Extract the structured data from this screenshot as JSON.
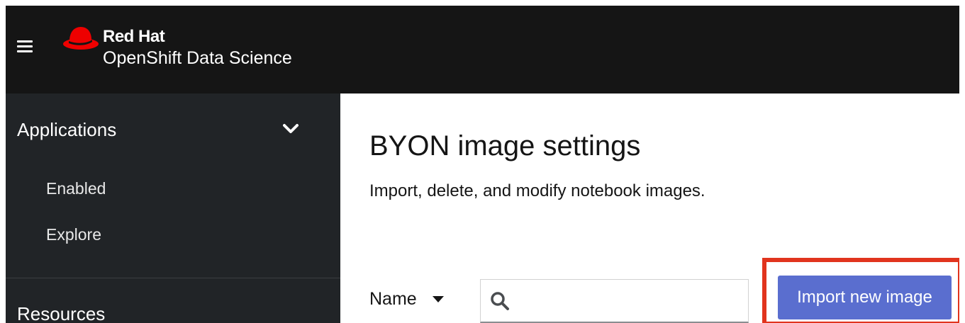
{
  "header": {
    "brand_line1": "Red Hat",
    "brand_line2": "OpenShift Data Science"
  },
  "sidebar": {
    "groups": [
      {
        "title": "Applications",
        "expanded": true,
        "items": [
          {
            "label": "Enabled"
          },
          {
            "label": "Explore"
          }
        ]
      },
      {
        "title": "Resources"
      }
    ]
  },
  "main": {
    "title": "BYON image settings",
    "description": "Import, delete, and modify notebook images.",
    "filter": {
      "selected": "Name",
      "search_value": ""
    },
    "import_button_label": "Import new image"
  },
  "colors": {
    "topbar": "#151515",
    "sidebar": "#212427",
    "hat_red": "#ee0000",
    "button": "#5a6ecf",
    "highlight": "#e1341e"
  },
  "icons": {
    "menu": "hamburger-icon",
    "logo": "red-hat-logo-icon",
    "expand": "chevron-down-icon",
    "filter_caret": "caret-down-icon",
    "search": "search-icon"
  }
}
